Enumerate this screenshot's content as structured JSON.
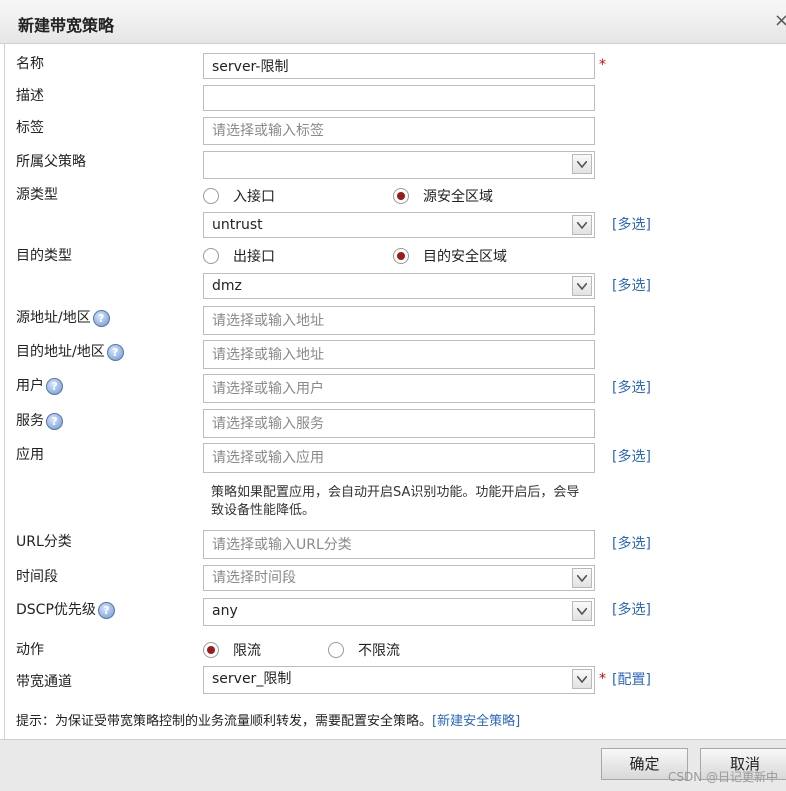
{
  "dialog": {
    "title": "新建带宽策略",
    "close": "×"
  },
  "form": {
    "name": {
      "label": "名称",
      "value": "server-限制",
      "required": "*"
    },
    "description": {
      "label": "描述",
      "value": ""
    },
    "tag": {
      "label": "标签",
      "placeholder": "请选择或输入标签"
    },
    "parent_policy": {
      "label": "所属父策略",
      "value": ""
    },
    "source_type": {
      "label": "源类型",
      "options": [
        {
          "label": "入接口",
          "selected": false
        },
        {
          "label": "源安全区域",
          "selected": true
        }
      ],
      "select_value": "untrust",
      "multi": "[多选]"
    },
    "dest_type": {
      "label": "目的类型",
      "options": [
        {
          "label": "出接口",
          "selected": false
        },
        {
          "label": "目的安全区域",
          "selected": true
        }
      ],
      "select_value": "dmz",
      "multi": "[多选]"
    },
    "source_address": {
      "label": "源地址/地区",
      "placeholder": "请选择或输入地址"
    },
    "dest_address": {
      "label": "目的地址/地区",
      "placeholder": "请选择或输入地址"
    },
    "user": {
      "label": "用户",
      "placeholder": "请选择或输入用户",
      "multi": "[多选]"
    },
    "service": {
      "label": "服务",
      "placeholder": "请选择或输入服务"
    },
    "application": {
      "label": "应用",
      "placeholder": "请选择或输入应用",
      "multi": "[多选]",
      "note": "策略如果配置应用，会自动开启SA识别功能。功能开启后，会导致设备性能降低。"
    },
    "url_category": {
      "label": "URL分类",
      "placeholder": "请选择或输入URL分类",
      "multi": "[多选]"
    },
    "time_range": {
      "label": "时间段",
      "placeholder": "请选择时间段"
    },
    "dscp": {
      "label": "DSCP优先级",
      "value": "any",
      "multi": "[多选]"
    },
    "action": {
      "label": "动作",
      "options": [
        {
          "label": "限流",
          "selected": true
        },
        {
          "label": "不限流",
          "selected": false
        }
      ]
    },
    "bandwidth_channel": {
      "label": "带宽通道",
      "value": "server_限制",
      "required": "*",
      "config": "[配置]"
    },
    "hint": {
      "text": "提示：为保证受带宽策略控制的业务流量顺利转发，需要配置安全策略。",
      "link": "[新建安全策略]"
    }
  },
  "footer": {
    "ok": "确定",
    "cancel": "取消",
    "watermark": "CSDN @日记更新中"
  },
  "icons": {
    "help": "help-icon",
    "dropdown": "chevron-down-icon"
  },
  "colors": {
    "link": "#2b67c5",
    "radio_selected": "#9b1c1c",
    "required": "#dd0000"
  }
}
